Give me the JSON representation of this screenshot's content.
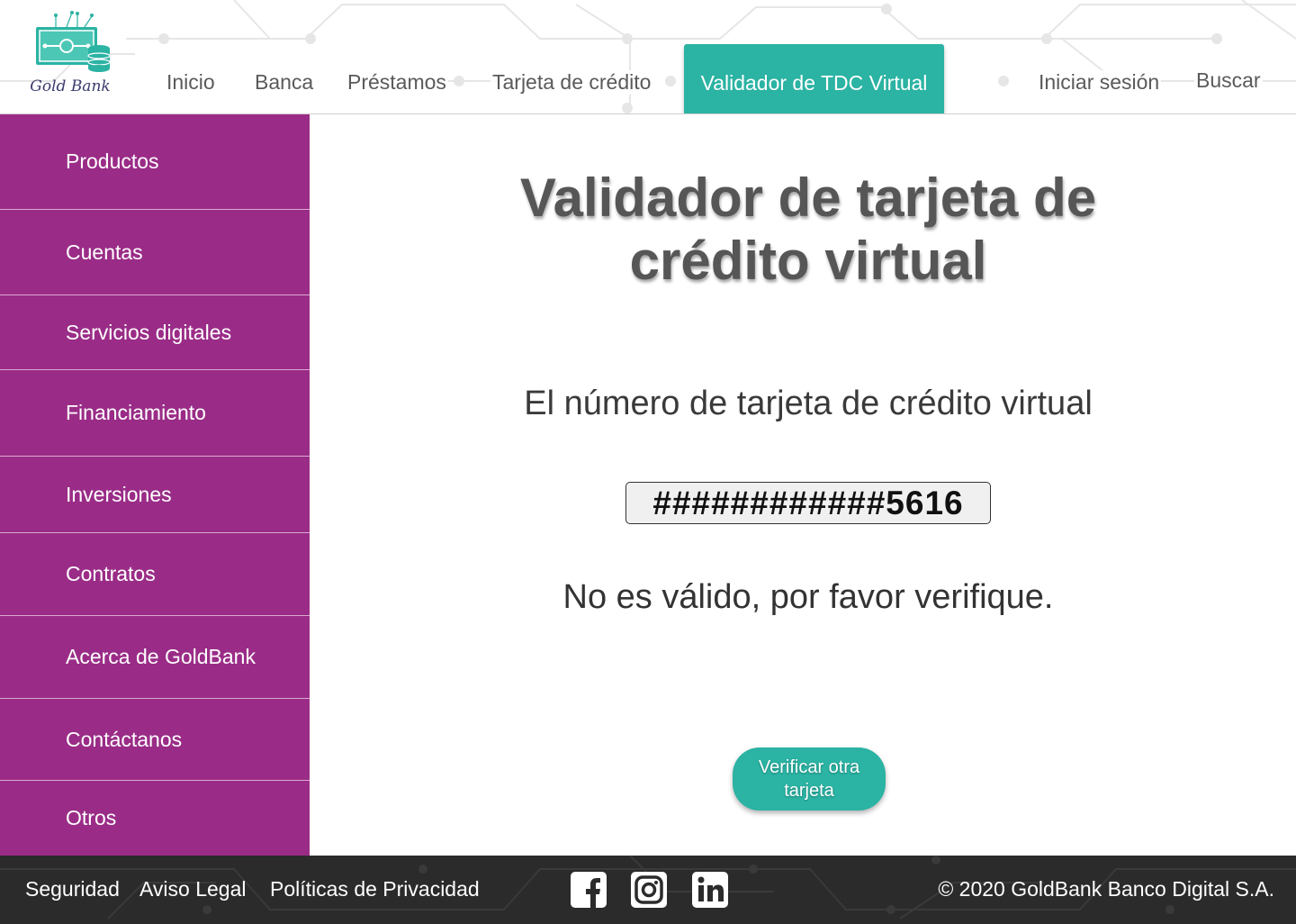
{
  "brand": {
    "name": "Gold Bank",
    "colors": {
      "accent": "#2bb3a3",
      "sidebar": "#9a2c87",
      "footer": "#2b2b2b"
    }
  },
  "header": {
    "nav": [
      {
        "label": "Inicio"
      },
      {
        "label": "Banca"
      },
      {
        "label": "Préstamos"
      },
      {
        "label": "Tarjeta de crédito"
      },
      {
        "label": "Validador de TDC Virtual",
        "active": true
      }
    ],
    "login_label": "Iniciar sesión",
    "search_label": "Buscar"
  },
  "sidebar": {
    "items": [
      {
        "label": "Productos"
      },
      {
        "label": "Cuentas"
      },
      {
        "label": "Servicios digitales"
      },
      {
        "label": "Financiamiento"
      },
      {
        "label": "Inversiones"
      },
      {
        "label": "Contratos"
      },
      {
        "label": "Acerca de GoldBank"
      },
      {
        "label": "Contáctanos"
      },
      {
        "label": "Otros"
      }
    ]
  },
  "main": {
    "title_line1": "Validador de tarjeta de",
    "title_line2": "crédito virtual",
    "subtitle": "El número de tarjeta de crédito virtual",
    "card_number": "############5616",
    "result": "No es válido, por favor verifique.",
    "verify_button": "Verificar otra tarjeta"
  },
  "footer": {
    "links": [
      {
        "label": "Seguridad"
      },
      {
        "label": "Aviso Legal"
      },
      {
        "label": "Políticas de Privacidad"
      }
    ],
    "social_icons": [
      "facebook-icon",
      "instagram-icon",
      "linkedin-icon"
    ],
    "copyright": "© 2020 GoldBank Banco Digital S.A."
  }
}
